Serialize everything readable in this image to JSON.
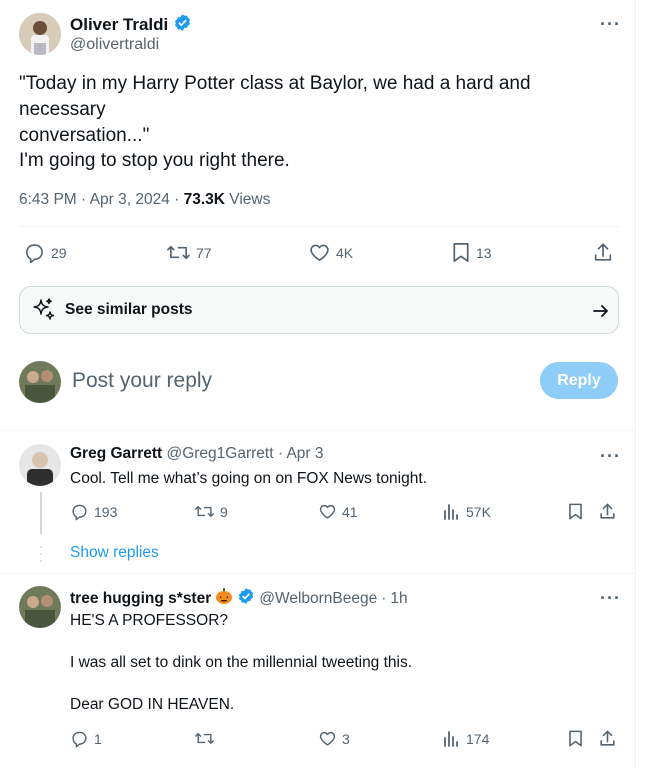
{
  "tweet": {
    "author_name": "Oliver Traldi",
    "author_handle": "@olivertraldi",
    "line1": "\"Today in my Harry Potter class at Baylor, we had a hard and necessary",
    "line2": "conversation...\"",
    "line3": "I'm going to stop you right there.",
    "time": "6:43 PM",
    "date": "Apr 3, 2024",
    "views_count": "73.3K",
    "views_label": "Views",
    "replies": "29",
    "reposts": "77",
    "likes": "4K",
    "bookmarks": "13"
  },
  "similar": {
    "label": "See similar posts"
  },
  "composer": {
    "placeholder": "Post your reply",
    "button": "Reply"
  },
  "replies": [
    {
      "name": "Greg Garrett",
      "handle": "@Greg1Garrett",
      "time": "Apr 3",
      "lines": [
        "Cool. Tell me what’s going on on FOX News tonight."
      ],
      "replies": "193",
      "reposts": "9",
      "likes": "41",
      "views": "57K",
      "show_replies": "Show replies"
    },
    {
      "name": "tree hugging s*ster",
      "handle": "@WelbornBeege",
      "time": "1h",
      "lines": [
        "HE'S A PROFESSOR?",
        "I was all set to dink on the millennial tweeting this.",
        "Dear GOD IN HEAVEN."
      ],
      "replies": "1",
      "reposts": "",
      "likes": "3",
      "views": "174"
    }
  ],
  "icons": {
    "verified": "verified-badge-icon",
    "more": "more-icon",
    "reply": "reply-icon",
    "repost": "repost-icon",
    "like": "heart-icon",
    "bookmark": "bookmark-icon",
    "share": "share-icon",
    "views": "analytics-icon",
    "sparkle": "sparkle-icon",
    "arrow": "arrow-right-icon"
  },
  "colors": {
    "accent": "#1d9bf0",
    "reply_button": "#8ecdf8",
    "muted": "#536471"
  }
}
